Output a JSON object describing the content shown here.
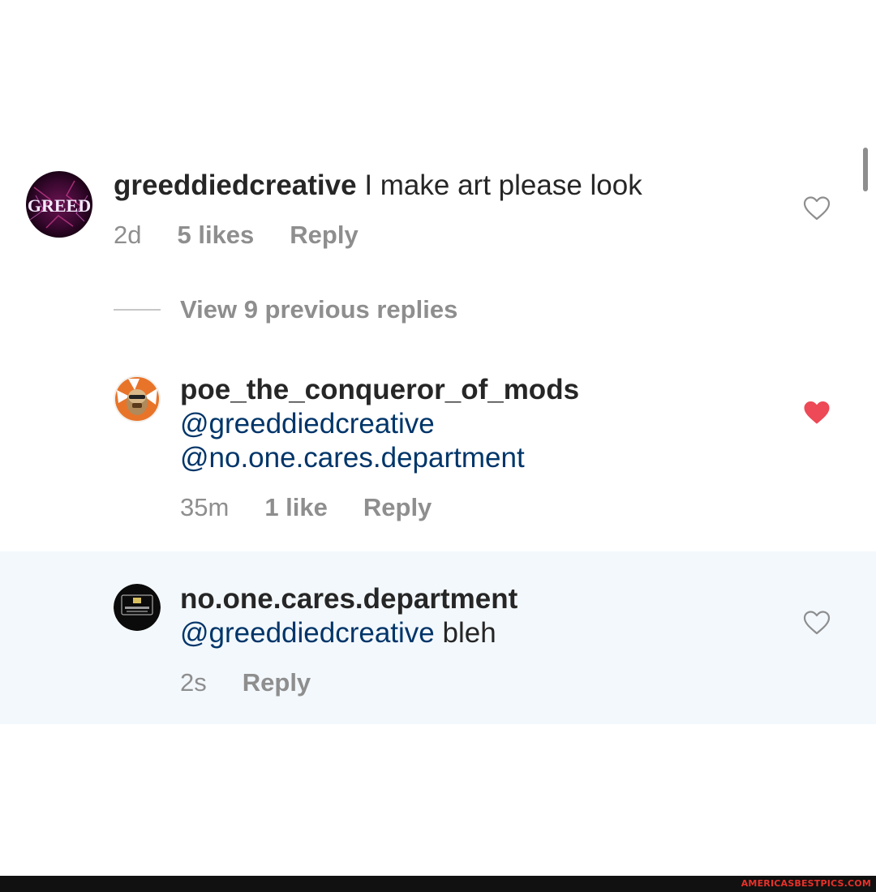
{
  "comments": [
    {
      "username": "greeddiedcreative",
      "text": " I make art please look",
      "time": "2d",
      "likes": "5 likes",
      "reply": "Reply",
      "liked": false
    },
    {
      "username": "poe_the_conqueror_of_mods",
      "mention1": "@greeddiedcreative",
      "mention2": "@no.one.cares.department",
      "time": "35m",
      "likes": "1 like",
      "reply": "Reply",
      "liked": true
    },
    {
      "username": "no.one.cares.department",
      "mention1": "@greeddiedcreative",
      "text": " bleh",
      "time": "2s",
      "reply": "Reply",
      "liked": false
    }
  ],
  "view_replies": "View 9 previous replies",
  "avatar1_text": "GREED",
  "watermark": "AMERICASBESTPICS.COM",
  "colors": {
    "heart_liked": "#ed4956",
    "mention": "#003569",
    "meta": "#8e8e8e",
    "highlight_bg": "#f3f8fc"
  }
}
